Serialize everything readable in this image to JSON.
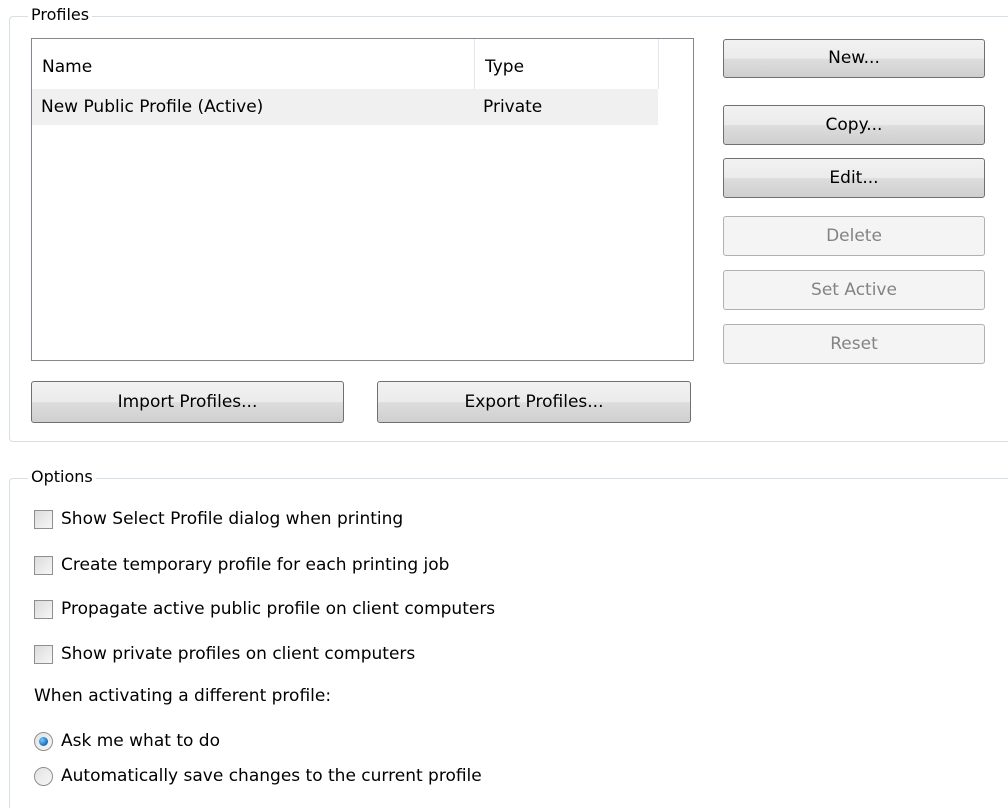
{
  "profiles_group": {
    "title": "Profiles",
    "list": {
      "columns": [
        "Name",
        "Type"
      ],
      "rows": [
        {
          "name": "New Public Profile (Active)",
          "type": "Private"
        }
      ]
    },
    "buttons": {
      "new": "New...",
      "copy": "Copy...",
      "edit": "Edit...",
      "delete": "Delete",
      "set_active": "Set Active",
      "reset": "Reset",
      "import": "Import Profiles...",
      "export": "Export Profiles..."
    }
  },
  "options_group": {
    "title": "Options",
    "checkboxes": [
      {
        "label": "Show Select Profile dialog when printing",
        "checked": false
      },
      {
        "label": "Create temporary profile for each printing job",
        "checked": false
      },
      {
        "label": "Propagate active public profile on client computers",
        "checked": false
      },
      {
        "label": "Show private profiles on client computers",
        "checked": false
      }
    ],
    "activation_label": "When activating a different profile:",
    "radios": [
      {
        "label": "Ask me what to do",
        "checked": true
      },
      {
        "label": "Automatically save changes to the current profile",
        "checked": false
      }
    ]
  }
}
